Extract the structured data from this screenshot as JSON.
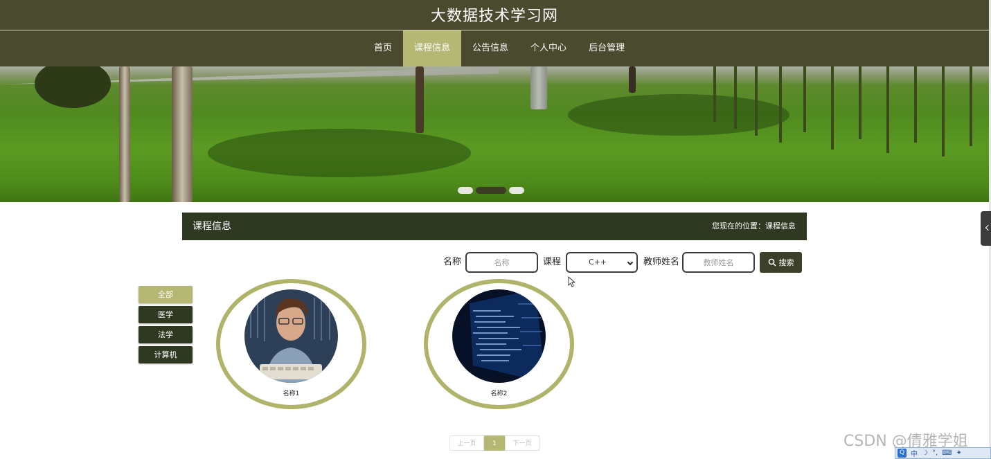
{
  "site": {
    "title": "大数据技术学习网"
  },
  "nav": {
    "items": [
      "首页",
      "课程信息",
      "公告信息",
      "个人中心",
      "后台管理"
    ],
    "active": "课程信息"
  },
  "section": {
    "title": "课程信息",
    "breadcrumb": "您现在的位置：课程信息"
  },
  "search": {
    "name_label": "名称",
    "name_placeholder": "名称",
    "course_label": "课程",
    "course_value": "C++",
    "teacher_label": "教师姓名",
    "teacher_placeholder": "教师姓名",
    "button_label": "搜索"
  },
  "categories": [
    "全部",
    "医学",
    "法学",
    "计算机"
  ],
  "courses": [
    {
      "name": "名称1"
    },
    {
      "name": "名称2"
    }
  ],
  "pagination": {
    "prev": "上一页",
    "current": "1",
    "next": "下一页"
  },
  "watermark": "CSDN @倩雅学姐",
  "ime": {
    "label": "中"
  },
  "colors": {
    "header": "#4a4a2e",
    "accent": "#b4b872",
    "dark": "#2f3820"
  }
}
